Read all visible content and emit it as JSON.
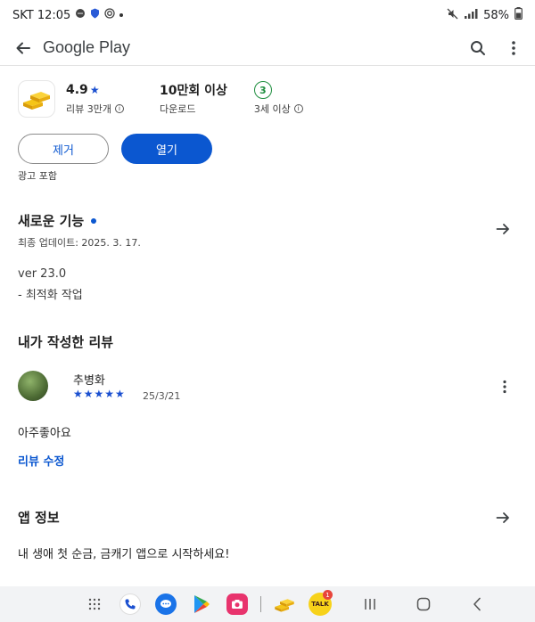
{
  "status_bar": {
    "carrier_time": "SKT 12:05",
    "battery": "58%"
  },
  "top_bar": {
    "brand": "Google Play"
  },
  "app_summary": {
    "rating": "4.9",
    "rating_star": "★",
    "reviews_label": "리뷰 3만개",
    "downloads": "10만회 이상",
    "downloads_label": "다운로드",
    "age_rating": "3",
    "age_label": "3세 이상"
  },
  "buttons": {
    "uninstall": "제거",
    "open": "열기"
  },
  "ad_note": "광고 포함",
  "whats_new": {
    "title": "새로운 기능",
    "last_updated": "최종 업데이트: 2025. 3. 17.",
    "version": "ver 23.0",
    "note": "- 최적화 작업"
  },
  "my_review": {
    "title": "내가 작성한 리뷰",
    "reviewer_name": "추병화",
    "stars": "★★★★★",
    "rating_value": 5,
    "date": "25/3/21",
    "text": "아주좋아요",
    "edit_label": "리뷰 수정"
  },
  "app_info": {
    "title": "앱 정보",
    "description": "내 생애 첫 순금, 금캐기 앱으로 시작하세요!"
  },
  "nav_bar": {
    "kakao_label": "TALK",
    "kakao_badge": "1"
  },
  "colors": {
    "accent": "#0b57d0",
    "star": "#1a4fd0",
    "age_green": "#1e8e3e",
    "badge_red": "#e8453c"
  }
}
